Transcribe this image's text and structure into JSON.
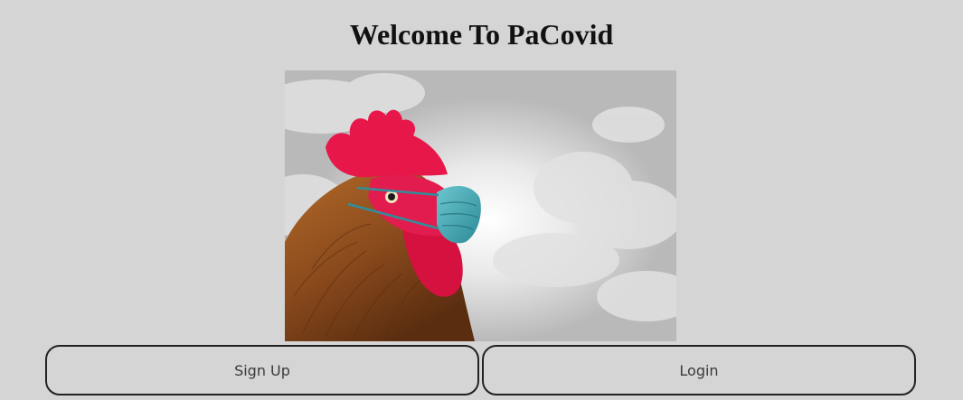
{
  "header": {
    "title": "Welcome To PaCovid"
  },
  "hero": {
    "subject": "rooster-wearing-face-mask",
    "colors": {
      "sky": "#c9c9c9",
      "comb": "#e8174a",
      "feathers": "#8a4a1c",
      "mask": "#3fa7b5"
    }
  },
  "actions": {
    "signup_label": "Sign Up",
    "login_label": "Login"
  }
}
